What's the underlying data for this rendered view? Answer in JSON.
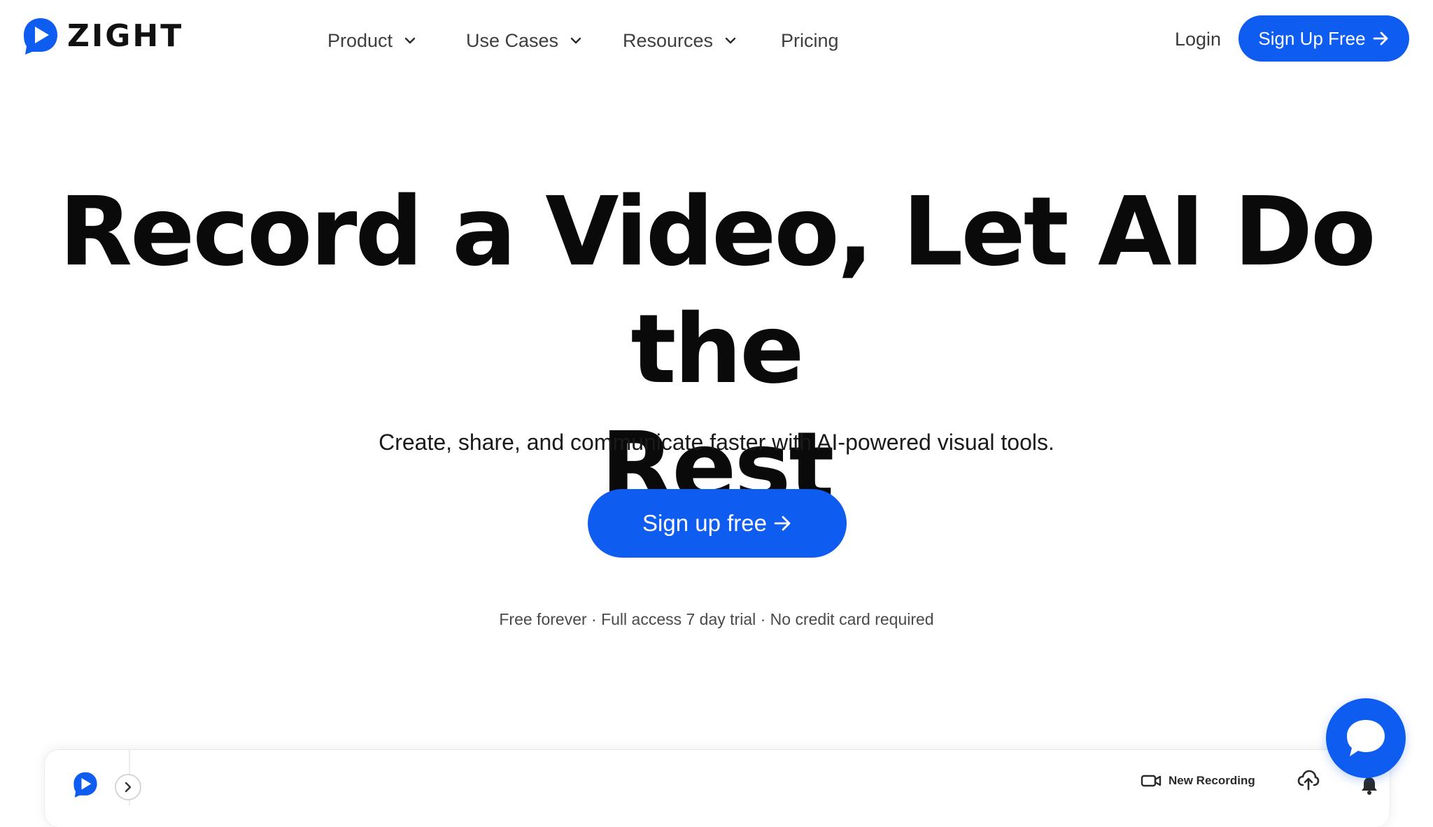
{
  "brand": {
    "name": "ZIGHT",
    "accent_color": "#0f5cf0"
  },
  "nav": {
    "items": [
      {
        "label": "Product",
        "has_dropdown": true
      },
      {
        "label": "Use Cases",
        "has_dropdown": true
      },
      {
        "label": "Resources",
        "has_dropdown": true
      },
      {
        "label": "Pricing",
        "has_dropdown": false
      }
    ],
    "login_label": "Login",
    "signup_label": "Sign Up Free"
  },
  "hero": {
    "title_line1": "Record a Video, Let AI Do the",
    "title_line2": "Rest",
    "subtitle": "Create, share, and communicate faster with AI-powered visual tools.",
    "cta_label": "Sign up free",
    "fine_print": "Free forever · Full access 7 day trial · No credit card required"
  },
  "app_preview": {
    "new_recording_label": "New Recording",
    "icons": [
      "zight-logo-icon",
      "chevron-right-icon",
      "video-camera-icon",
      "cloud-upload-icon",
      "bell-icon"
    ]
  },
  "chat": {
    "icon": "chat-bubble-icon"
  }
}
